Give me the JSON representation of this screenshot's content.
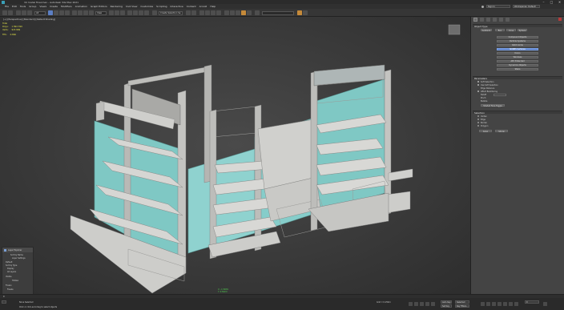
{
  "window": {
    "title": "3d model final.max - Autodesk 3ds Max 2021",
    "min_glyph": "–",
    "max_glyph": "□",
    "close_glyph": "✕"
  },
  "menu": {
    "items": [
      "File",
      "Edit",
      "Tools",
      "Group",
      "Views",
      "Create",
      "Modifiers",
      "Animation",
      "Graph Editors",
      "Rendering",
      "Civil View",
      "Customize",
      "Scripting",
      "Interactive",
      "Content",
      "Arnold",
      "Help"
    ],
    "signin_label": "Sign In",
    "workspace_label": "Workspaces: Default"
  },
  "toolbar": {
    "selection_filter": "All",
    "view_dropdown": "View",
    "named_set": "Create Selection Se"
  },
  "viewport": {
    "label": "[+] [Perspective] [Standard] [Default Shading]",
    "stats": {
      "total_label": "Total",
      "polys_label": "Polys:",
      "polys_value": "1 892 399",
      "verts_label": "Verts:",
      "verts_value": "915 899",
      "fps_label": "FPS:",
      "fps_value": "0.866"
    }
  },
  "command_panel": {
    "dropdown": "Standard Primitives",
    "object_type_header": "Object Type",
    "autogrid_label": "AutoGrid",
    "object_buttons": [
      "Box",
      "Cone",
      "Sphere",
      "GeoSphere",
      "Cylinder",
      "Tube",
      "Torus",
      "Pyramid",
      "Teapot",
      "Plane",
      "TextPlus"
    ],
    "modifiers_header": "Modifiers",
    "subbuttons": [
      "Compound Objects",
      "Particle Systems",
      "Patch Grids",
      "NURBS Surfaces",
      "Doors",
      "Windows",
      "AEC Extended",
      "Dynamics Objects",
      "Stairs"
    ],
    "selected_index": 3,
    "params_header": "Parameters",
    "rows": [
      "Soft Selection",
      "Use Soft Selection",
      "Edge Distance",
      "Affect Backfacing",
      "Falloff",
      "Pinch",
      "Bubble",
      "Shaded Face Toggle"
    ],
    "lower_header": "Selection",
    "radio_labels": [
      "Vertex",
      "Edge",
      "Border",
      "Polygon"
    ],
    "buttons": [
      "Grow",
      "Shrink"
    ]
  },
  "float_panel": {
    "title": "Layer Explorer",
    "items": [
      "Sort by Name",
      "Layer Settings",
      "Default",
      "Sort by Type",
      "Display",
      "All Layers",
      "Visible",
      "Hidden",
      "Frozen",
      "Freeze"
    ]
  },
  "status": {
    "selection": "None Selected",
    "prompt": "Click or click-and-drag to select objects",
    "x_label": "X:",
    "x_value": "-1.548m",
    "y_label": "Y:",
    "y_value": "0.562m",
    "z_label": "Z:",
    "z_value": "0.0m",
    "grid_label": "Grid = 0.254m",
    "frame": "0",
    "key_mode": "Auto Key",
    "selected_dropdown": "Selected",
    "set_key": "Set Key",
    "key_filters": "Key Filters..."
  },
  "colors": {
    "accent": "#5c7fc4",
    "panel_teal": "#7fc8c4",
    "shelf_gray": "#c9c9c6",
    "coords_green": "#4fd04f"
  }
}
